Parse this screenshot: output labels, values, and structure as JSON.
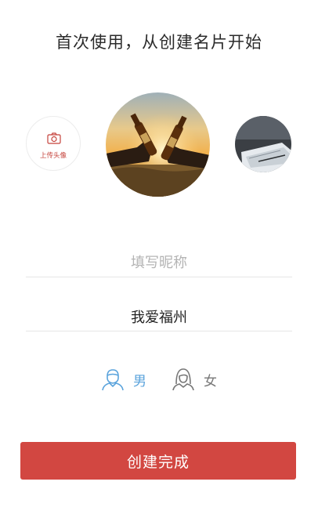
{
  "header": {
    "title": "首次使用，从创建名片开始"
  },
  "avatar": {
    "upload_label": "上传头像",
    "upload_icon": "camera-icon",
    "selected": "beer-toast-photo",
    "alternate": "desk-papers-photo"
  },
  "form": {
    "nickname_placeholder": "填写昵称",
    "nickname_value": "",
    "region_value": "我爱福州",
    "gender": {
      "male_label": "男",
      "female_label": "女",
      "selected": "male",
      "male_color": "#5aa3dc",
      "female_color": "#777777"
    }
  },
  "submit_label": "创建完成",
  "colors": {
    "accent": "#d24741",
    "upload_text": "#c5423b"
  }
}
